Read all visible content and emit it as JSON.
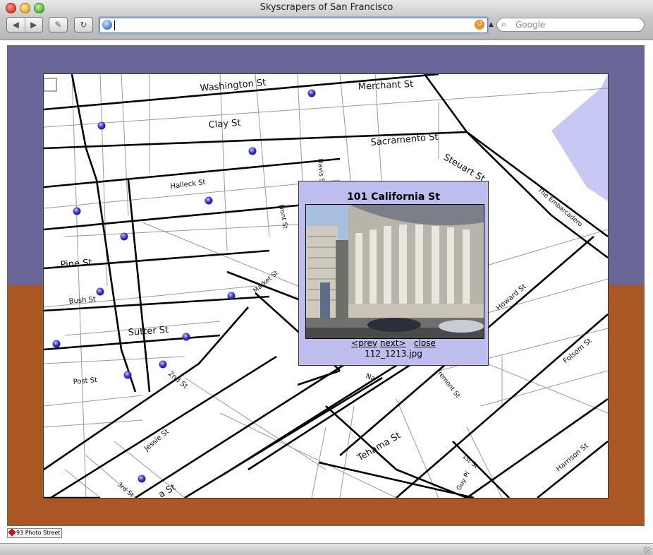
{
  "window": {
    "title": "Skyscrapers of San Francisco"
  },
  "toolbar": {
    "back_icon": "back-arrow-icon",
    "forward_icon": "forward-arrow-icon",
    "edit_icon": "pencil-icon",
    "reload_icon": "reload-icon",
    "url_value": "",
    "search_placeholder": "Google"
  },
  "map": {
    "streets": [
      {
        "label": "Washington St"
      },
      {
        "label": "Merchant St"
      },
      {
        "label": "Clay St"
      },
      {
        "label": "Sacramento St"
      },
      {
        "label": "Steuart St"
      },
      {
        "label": "Davis St"
      },
      {
        "label": "Halleck St"
      },
      {
        "label": "The Embarcadero"
      },
      {
        "label": "Front St"
      },
      {
        "label": "Pine St"
      },
      {
        "label": "Market St"
      },
      {
        "label": "Howard St"
      },
      {
        "label": "Bush St"
      },
      {
        "label": "Sutter St"
      },
      {
        "label": "Folsom St"
      },
      {
        "label": "2nd St"
      },
      {
        "label": "Post St"
      },
      {
        "label": "Fremont St"
      },
      {
        "label": "Jessie St"
      },
      {
        "label": "Tehama St"
      },
      {
        "label": "1st St"
      },
      {
        "label": "Harrison St"
      },
      {
        "label": "3rd St"
      },
      {
        "label": "Guy Pl"
      },
      {
        "label": "Na"
      },
      {
        "label": "a St"
      }
    ],
    "marker_count": 14
  },
  "popup": {
    "title": "101 California St",
    "prev_label": "<prev",
    "next_label": "next>",
    "close_label": "close",
    "filename": "112_1213.jpg"
  },
  "status": {
    "badge_label": "93 Photo Street"
  },
  "colors": {
    "band_top": "#6a6798",
    "band_bottom": "#ab5724",
    "popup_bg": "#bdbdee",
    "marker": "#3b3bd6",
    "water": "#c8c8f4"
  }
}
